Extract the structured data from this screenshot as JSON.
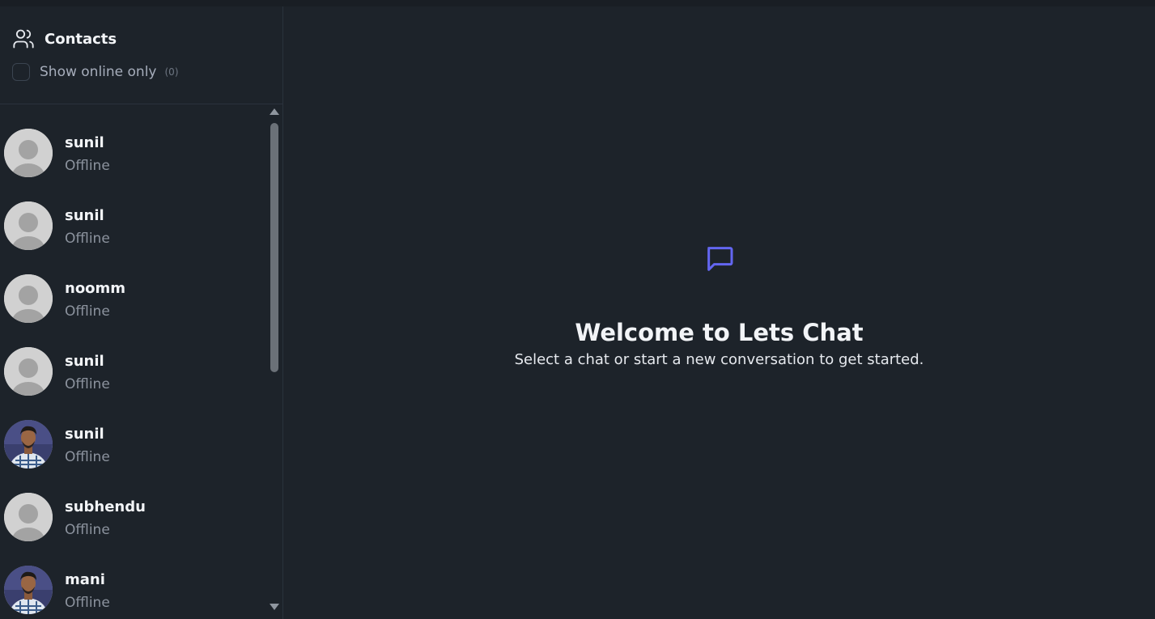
{
  "sidebar": {
    "title": "Contacts",
    "title_icon": "users-icon",
    "filter": {
      "label": "Show online only",
      "count": "(0)",
      "checked": false
    },
    "contacts": [
      {
        "name": "sunil",
        "status": "Offline",
        "avatar": "default"
      },
      {
        "name": "sunil",
        "status": "Offline",
        "avatar": "default"
      },
      {
        "name": "noomm",
        "status": "Offline",
        "avatar": "default"
      },
      {
        "name": "sunil",
        "status": "Offline",
        "avatar": "default"
      },
      {
        "name": "sunil",
        "status": "Offline",
        "avatar": "photo"
      },
      {
        "name": "subhendu",
        "status": "Offline",
        "avatar": "default"
      },
      {
        "name": "mani",
        "status": "Offline",
        "avatar": "photo"
      }
    ]
  },
  "main": {
    "welcome_icon": "message-square-icon",
    "welcome_title": "Welcome to Lets Chat",
    "welcome_subtitle": "Select a chat or start a new conversation to get started."
  },
  "colors": {
    "background": "#1d232a",
    "accent": "#6366f1",
    "border": "#2a323c"
  }
}
